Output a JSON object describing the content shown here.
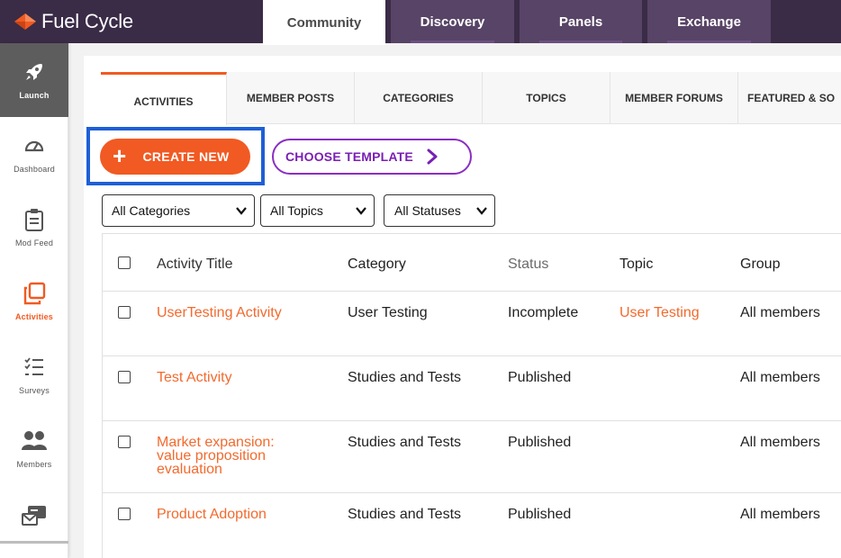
{
  "app": {
    "logo_text": "Fuel Cycle"
  },
  "top_nav": {
    "tabs": [
      {
        "label": "Community"
      },
      {
        "label": "Discovery"
      },
      {
        "label": "Panels"
      },
      {
        "label": "Exchange"
      }
    ]
  },
  "sidebar": {
    "items": [
      {
        "label": "Launch",
        "icon": "rocket-icon"
      },
      {
        "label": "Dashboard",
        "icon": "gauge-icon"
      },
      {
        "label": "Mod Feed",
        "icon": "clipboard-icon"
      },
      {
        "label": "Activities",
        "icon": "activities-icon"
      },
      {
        "label": "Surveys",
        "icon": "checklist-icon"
      },
      {
        "label": "Members",
        "icon": "people-icon"
      },
      {
        "label": "",
        "icon": "mail-card-icon"
      }
    ]
  },
  "subtabs": [
    {
      "label": "ACTIVITIES"
    },
    {
      "label": "MEMBER POSTS"
    },
    {
      "label": "CATEGORIES"
    },
    {
      "label": "TOPICS"
    },
    {
      "label": "MEMBER FORUMS"
    },
    {
      "label": "FEATURED & SO"
    }
  ],
  "actions": {
    "create_new": "CREATE NEW",
    "choose_template": "CHOOSE TEMPLATE"
  },
  "filters": {
    "categories": "All Categories",
    "topics": "All Topics",
    "statuses": "All Statuses"
  },
  "table": {
    "headers": {
      "title": "Activity Title",
      "category": "Category",
      "status": "Status",
      "topic": "Topic",
      "group": "Group"
    },
    "rows": [
      {
        "title_lines": [
          "UserTesting Activity"
        ],
        "category": "User Testing",
        "status": "Incomplete",
        "topic": "User Testing",
        "group": "All members"
      },
      {
        "title_lines": [
          "Test Activity"
        ],
        "category": "Studies and Tests",
        "status": "Published",
        "topic": "",
        "group": "All members"
      },
      {
        "title_lines": [
          "Market expansion:",
          "value proposition",
          "evaluation"
        ],
        "category": "Studies and Tests",
        "status": "Published",
        "topic": "",
        "group": "All members"
      },
      {
        "title_lines": [
          "Product Adoption"
        ],
        "category": "Studies and Tests",
        "status": "Published",
        "topic": "",
        "group": "All members"
      }
    ]
  },
  "colors": {
    "accent": "#f15a22",
    "template": "#8a2ec3",
    "topbar": "#3a2b47",
    "highlight": "#1f5fd6"
  }
}
